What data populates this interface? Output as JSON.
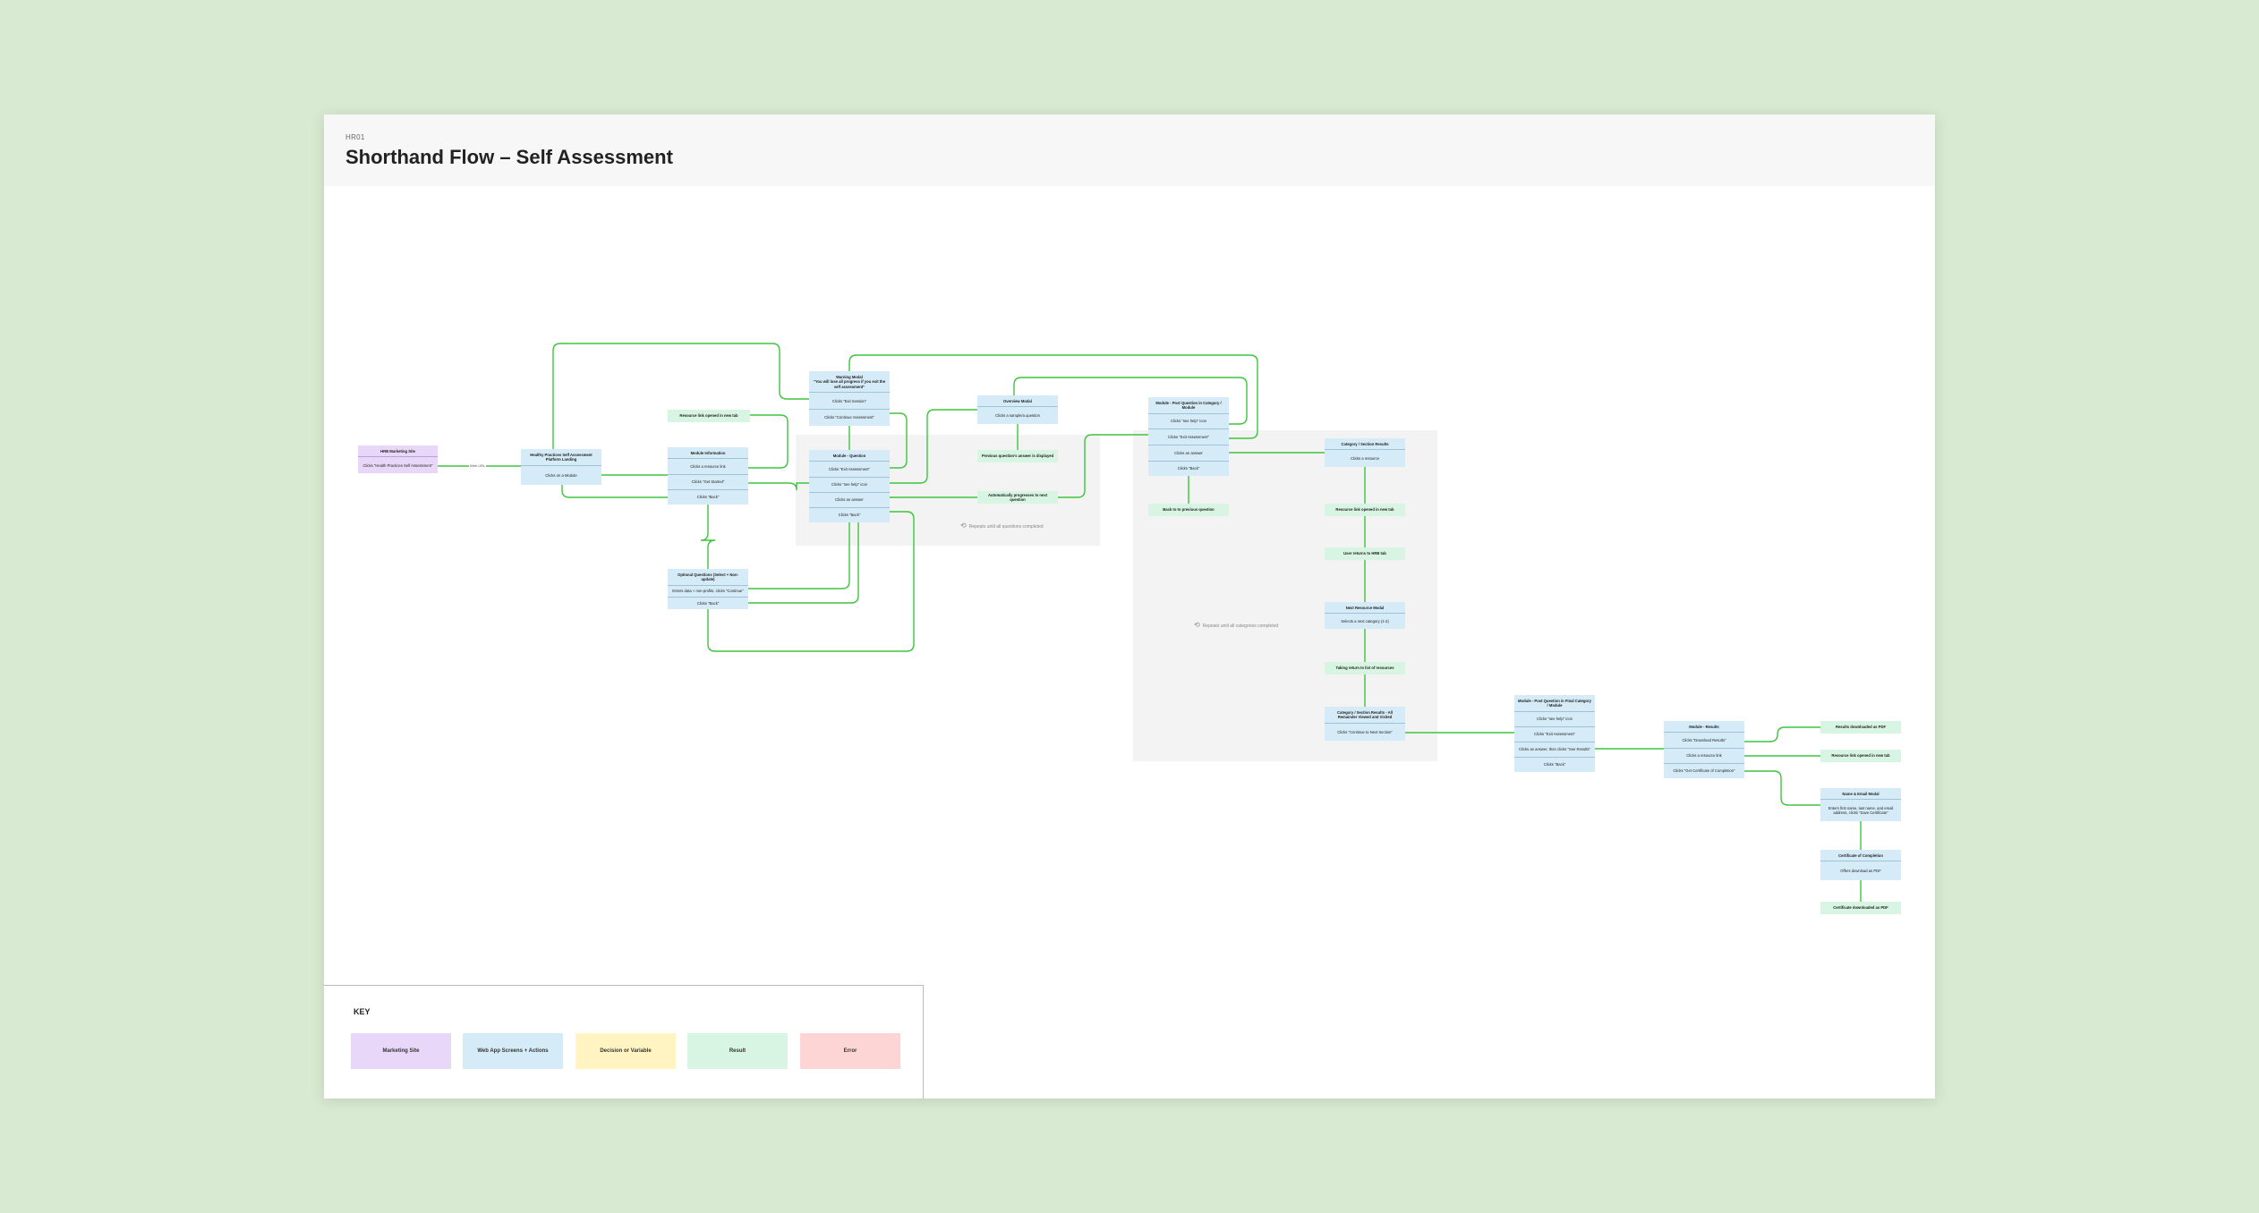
{
  "header": {
    "label": "HR01",
    "title": "Shorthand Flow – Self Assessment"
  },
  "regions": [
    {
      "label": "Repeats until all questions completed"
    },
    {
      "label": "Repeats until all categories completed"
    }
  ],
  "edge_labels": [
    "Web URL"
  ],
  "nodes": {
    "marketing_site": {
      "title": "HRB Marketing Site",
      "rows": [
        "Clicks \"Health Practices Self Assessment\""
      ]
    },
    "landing": {
      "title": "Healthy Practices Self Assessment Platform Landing",
      "rows": [
        "Clicks on a Module"
      ]
    },
    "resource_new_tab": {
      "title": "Resource link opened in new tab"
    },
    "module_info": {
      "title": "Module Information",
      "rows": [
        "Clicks a resource link",
        "Clicks \"Get Started\"",
        "Clicks \"Back\""
      ]
    },
    "optional_q": {
      "title": "Optional Questions (Select + Non-update)",
      "rows": [
        "Enters data + non-profits, clicks \"Continue\"",
        "Clicks \"Back\""
      ]
    },
    "warning_modal": {
      "title": "Warning Modal\n\"You will lose all progress if you exit the self assessment\"",
      "rows": [
        "Clicks \"Exit Session\"",
        "Clicks \"Continue Assessment\""
      ]
    },
    "module_question": {
      "title": "Module - Question",
      "rows": [
        "Clicks \"Exit Assessment\"",
        "Clicks \"see help\" icon",
        "Clicks an answer",
        "Clicks \"Back\""
      ]
    },
    "overview_modal": {
      "title": "Overview Modal",
      "rows": [
        "Clicks a sample/a question"
      ]
    },
    "prev_q_result": {
      "title": "Previous question's answer is displayed"
    },
    "auto_progress": {
      "title": "Automatically progresses to next question"
    },
    "post_q_module": {
      "title": "Module - Post Question in Category / Module",
      "rows": [
        "Clicks \"see help\" icon",
        "Clicks \"Exit Assessment\"",
        "Clicks an answer",
        "Clicks \"Back\""
      ]
    },
    "back_prev": {
      "title": "Back to to previous question"
    },
    "category_results": {
      "title": "Category / Section Results",
      "rows": [
        "Clicks a resource"
      ]
    },
    "resource_opened": {
      "title": "Resource link opened in new tab"
    },
    "user_returns": {
      "title": "User returns to HRB tab"
    },
    "next_resource_modal": {
      "title": "Next Resource Modal",
      "rows": [
        "Selects a next category (1-2)"
      ]
    },
    "taking_return": {
      "title": "Taking return to list of resources"
    },
    "category_section_results": {
      "title": "Category / Section Results - All Remainder Viewed and Visited",
      "rows": [
        "Clicks \"Continue to Next Section\""
      ]
    },
    "post_q_final": {
      "title": "Module - Post Question in Final Category / Module",
      "rows": [
        "Clicks \"see help\" icon",
        "Clicks \"Exit Assessment\"",
        "Clicks an answer, then clicks \"See Results\"",
        "Clicks \"Back\""
      ]
    },
    "module_results": {
      "title": "Module - Results",
      "rows": [
        "Clicks \"Download Results\"",
        "Clicks a resource link",
        "Clicks \"Get Certificate of Completion\""
      ]
    },
    "results_pdf": {
      "title": "Results downloaded as PDF"
    },
    "resource_opened_2": {
      "title": "Resource link opened in new tab"
    },
    "name_email_modal": {
      "title": "Name & Email Modal",
      "rows": [
        "Enters first name, last name, and email address, clicks \"Save Certificate\""
      ]
    },
    "certificate": {
      "title": "Certificate of Completion",
      "rows": [
        "Offers download as PDF"
      ]
    },
    "certificate_pdf": {
      "title": "Certificate downloaded as PDF"
    }
  },
  "key": {
    "title": "KEY",
    "items": [
      {
        "label": "Marketing Site",
        "color": "#e8d7f8"
      },
      {
        "label": "Web App Screens + Actions",
        "color": "#d5ecf8"
      },
      {
        "label": "Decision or Variable",
        "color": "#fff4c2"
      },
      {
        "label": "Result",
        "color": "#d7f5e2"
      },
      {
        "label": "Error",
        "color": "#fdd5d5"
      }
    ]
  },
  "colors": {
    "background": "#d9ead2",
    "connector": "#3ec43e"
  }
}
